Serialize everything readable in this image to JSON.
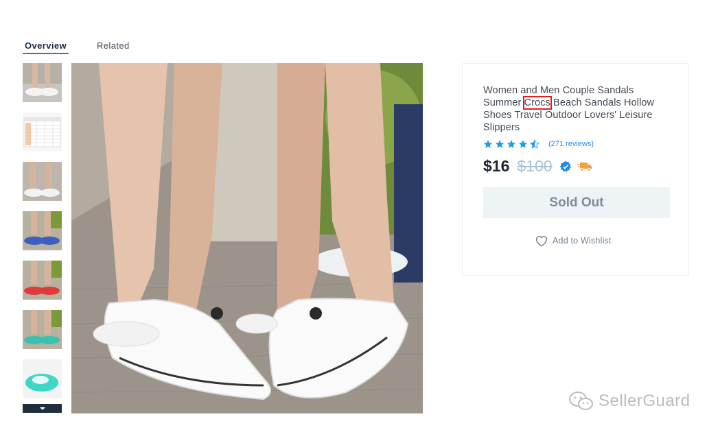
{
  "tabs": [
    {
      "label": "Overview",
      "active": true
    },
    {
      "label": "Related",
      "active": false
    }
  ],
  "thumbnails": [
    {
      "name": "white-pair-walk"
    },
    {
      "name": "size-chart"
    },
    {
      "name": "white-pair-floor"
    },
    {
      "name": "blue-pair"
    },
    {
      "name": "red-pair"
    },
    {
      "name": "teal-pair"
    },
    {
      "name": "teal-single"
    }
  ],
  "product": {
    "title_pre": "Women and Men Couple Sandals Summer",
    "title_highlight": "Crocs",
    "title_post": "Beach Sandals Hollow Shoes Travel Outdoor Lovers' Leisure Slippers",
    "rating": 4.5,
    "reviews": "(271 reviews)",
    "price": "$16",
    "old_price": "$100",
    "sold_out_label": "Sold Out",
    "wishlist_label": "Add to Wishlist"
  },
  "colors": {
    "star": "#1f9bea",
    "verified": "#1f8ceb",
    "truck": "#f0a23c",
    "highlight": "#e02020"
  },
  "watermark": {
    "text": "SellerGuard"
  }
}
